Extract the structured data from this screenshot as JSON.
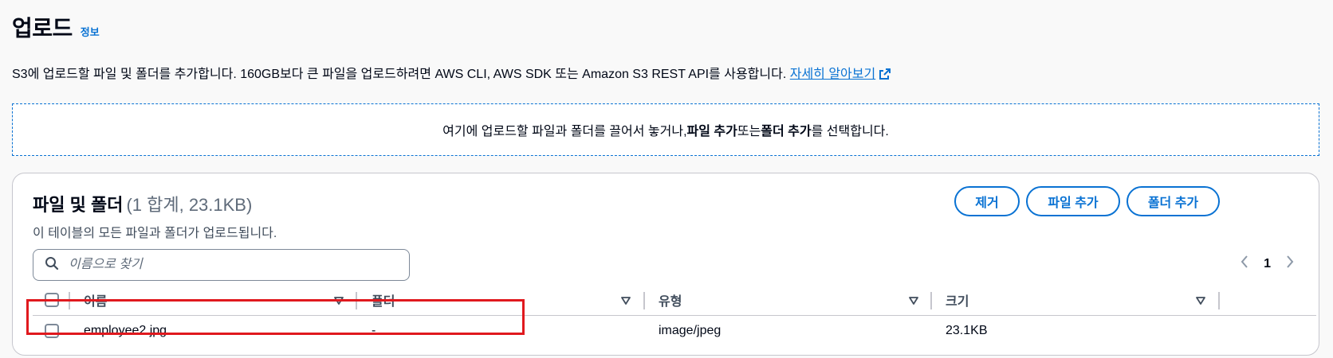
{
  "header": {
    "title": "업로드",
    "info_link": "정보"
  },
  "description": {
    "text": "S3에 업로드할 파일 및 폴더를 추가합니다. 160GB보다 큰 파일을 업로드하려면 AWS CLI, AWS SDK 또는 Amazon S3 REST API를 사용합니다.",
    "learn_more": "자세히 알아보기"
  },
  "dropzone": {
    "prefix": "여기에 업로드할 파일과 폴더를 끌어서 놓거나, ",
    "add_files": "파일 추가",
    "middle": " 또는 ",
    "add_folder": "폴더 추가",
    "suffix": "를 선택합니다."
  },
  "panel": {
    "title": "파일 및 폴더",
    "count": "(1 합계, 23.1KB)",
    "subtitle": "이 테이블의 모든 파일과 폴더가 업로드됩니다.",
    "buttons": {
      "remove": "제거",
      "add_files": "파일 추가",
      "add_folder": "폴더 추가"
    },
    "search": {
      "placeholder": "이름으로 찾기"
    },
    "pagination": {
      "current_page": "1"
    }
  },
  "table": {
    "columns": [
      "이름",
      "폴더",
      "유형",
      "크기"
    ],
    "rows": [
      {
        "name": "employee2.jpg",
        "folder": "-",
        "type": "image/jpeg",
        "size": "23.1KB"
      }
    ]
  },
  "icons": [
    "external-link-icon",
    "search-icon",
    "chevron-left-icon",
    "chevron-right-icon",
    "sort-caret-icon"
  ],
  "colors": {
    "link": "#0972d3",
    "highlight": "#e0191e",
    "text": "#000716"
  }
}
